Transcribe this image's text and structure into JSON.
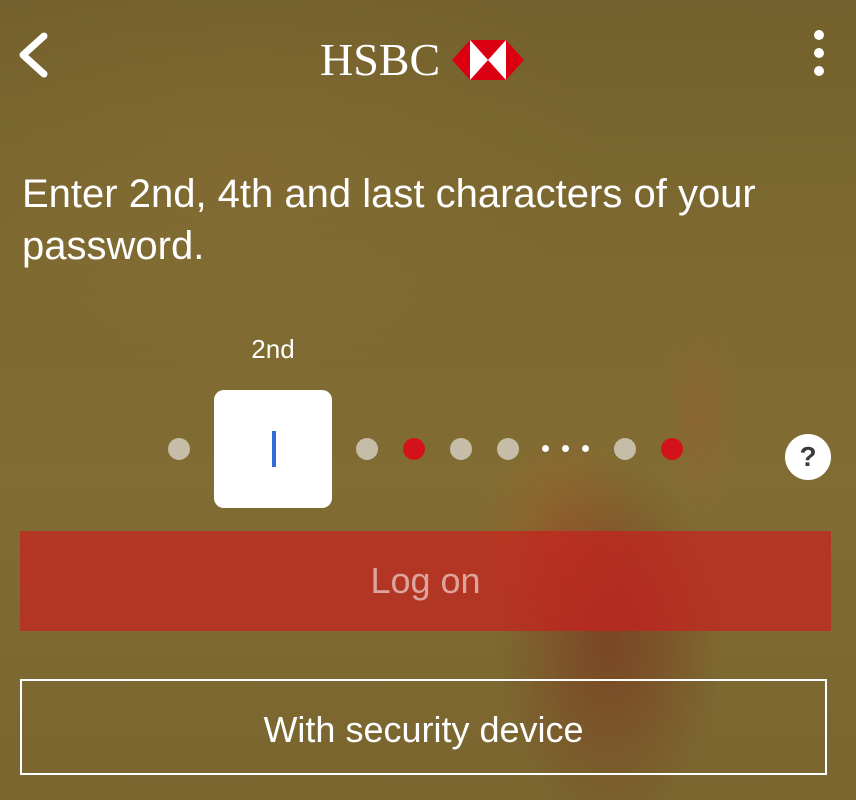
{
  "header": {
    "logo_text": "HSBC",
    "back_icon": "chevron-left-icon",
    "menu_icon": "more-vertical-icon",
    "brand_color": "#db0011"
  },
  "prompt": {
    "instruction": "Enter 2nd, 4th and last characters of your password.",
    "current_char_label": "2nd"
  },
  "password_indicator": {
    "positions": [
      "grey",
      "active-input",
      "grey",
      "red",
      "grey",
      "grey",
      "ellipsis",
      "grey",
      "red"
    ],
    "dot_color": "#c5bda7",
    "required_color": "#d3121b",
    "caret_color": "#2f6dda"
  },
  "help": {
    "label": "?",
    "icon": "help-icon"
  },
  "buttons": {
    "logon_label": "Log on",
    "security_device_label": "With security device",
    "logon_color": "#cc1e1e"
  }
}
